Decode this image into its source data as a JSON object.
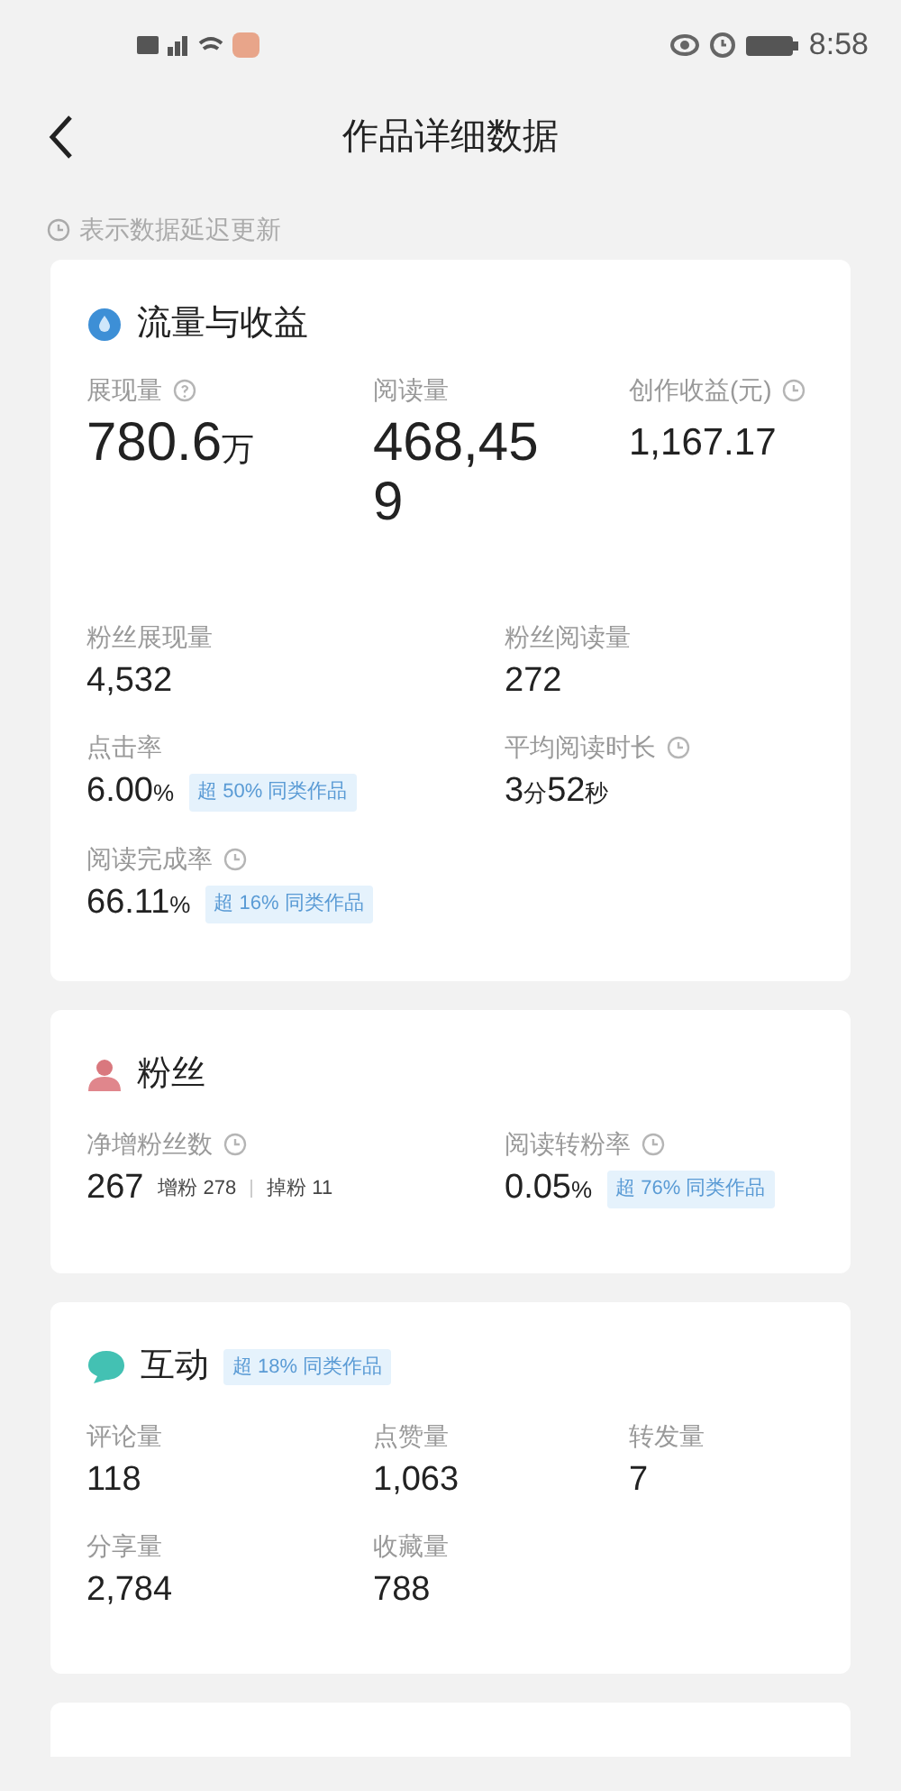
{
  "status_bar": {
    "time": "8:58"
  },
  "header": {
    "title": "作品详细数据"
  },
  "notice": "表示数据延迟更新",
  "sections": [
    {
      "title": "流量与收益",
      "top_metrics": [
        {
          "label": "展现量",
          "info": true,
          "value": "780.6万"
        },
        {
          "label": "阅读量",
          "info": false,
          "value": "468,459"
        },
        {
          "label": "创作收益(元)",
          "info": true,
          "value": "1,167.17"
        }
      ],
      "metrics": [
        {
          "label": "粉丝展现量",
          "info": false,
          "value": "4,532"
        },
        {
          "label": "粉丝阅读量",
          "info": false,
          "value": "272"
        },
        {
          "label": "点击率",
          "info": false,
          "value": "6.00%",
          "badge": "超 50% 同类作品"
        },
        {
          "label": "平均阅读时长",
          "info": true,
          "value": "3分52秒"
        },
        {
          "label": "阅读完成率",
          "info": true,
          "value": "66.11%",
          "badge": "超 16% 同类作品"
        }
      ]
    },
    {
      "title": "粉丝",
      "metrics": [
        {
          "label": "净增粉丝数",
          "info": true,
          "value": "267",
          "breakdown": [
            "增粉 278",
            "掉粉 11"
          ]
        },
        {
          "label": "阅读转粉率",
          "info": true,
          "value": "0.05%",
          "badge": "超 76% 同类作品"
        }
      ]
    },
    {
      "title": "互动",
      "badge": "超 18% 同类作品",
      "metrics": [
        {
          "label": "评论量",
          "info": false,
          "value": "118"
        },
        {
          "label": "点赞量",
          "info": false,
          "value": "1,063"
        },
        {
          "label": "转发量",
          "info": false,
          "value": "7"
        },
        {
          "label": "分享量",
          "info": false,
          "value": "2,784"
        },
        {
          "label": "收藏量",
          "info": false,
          "value": "788"
        }
      ]
    }
  ]
}
